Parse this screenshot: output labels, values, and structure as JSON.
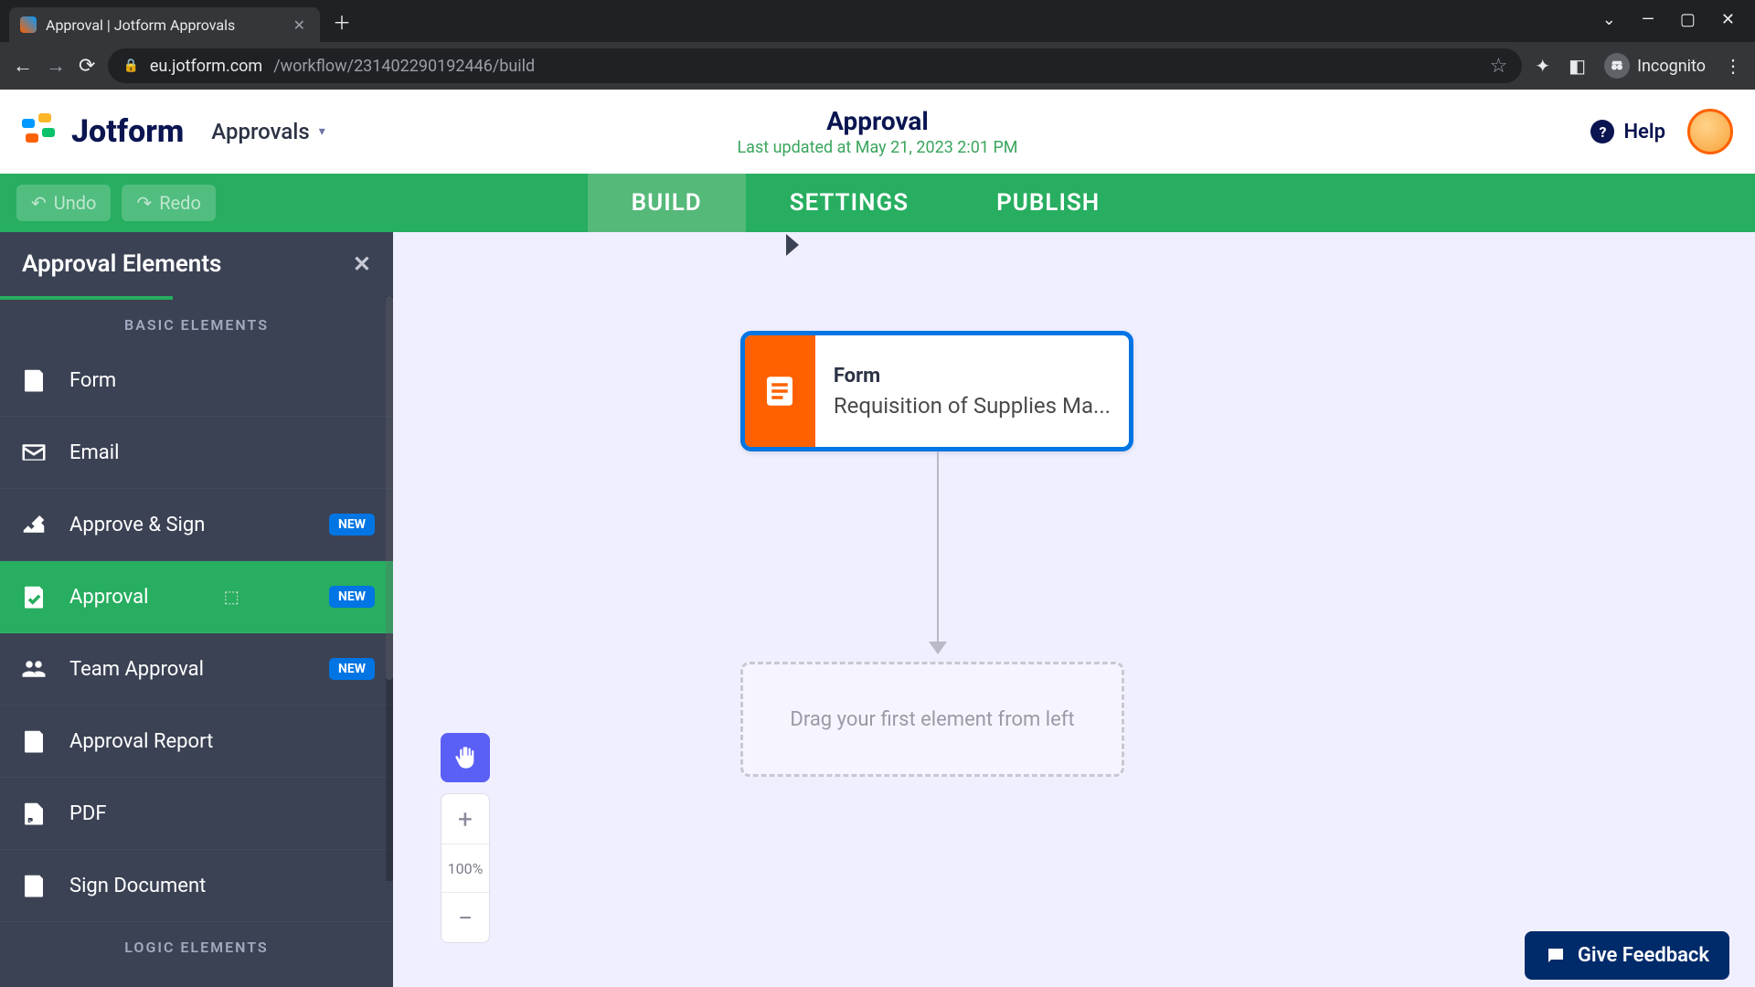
{
  "browser": {
    "tab_title": "Approval | Jotform Approvals",
    "url_host": "eu.jotform.com",
    "url_path": "/workflow/231402290192446/build",
    "incognito_label": "Incognito"
  },
  "header": {
    "logo_text": "Jotform",
    "breadcrumb": "Approvals",
    "title": "Approval",
    "subtitle": "Last updated at May 21, 2023 2:01 PM",
    "help_label": "Help"
  },
  "toolbar": {
    "undo": "Undo",
    "redo": "Redo"
  },
  "tabs": {
    "build": "BUILD",
    "settings": "SETTINGS",
    "publish": "PUBLISH"
  },
  "sidebar": {
    "title": "Approval Elements",
    "section_basic": "BASIC ELEMENTS",
    "section_logic": "LOGIC ELEMENTS",
    "new_badge": "NEW",
    "items": [
      {
        "label": "Form",
        "badge": false
      },
      {
        "label": "Email",
        "badge": false
      },
      {
        "label": "Approve & Sign",
        "badge": true
      },
      {
        "label": "Approval",
        "badge": true
      },
      {
        "label": "Team Approval",
        "badge": true
      },
      {
        "label": "Approval Report",
        "badge": false
      },
      {
        "label": "PDF",
        "badge": false
      },
      {
        "label": "Sign Document",
        "badge": false
      }
    ]
  },
  "canvas": {
    "node_title": "Form",
    "node_subtitle": "Requisition of Supplies Ma...",
    "dropzone_text": "Drag your first element from left",
    "zoom": "100%"
  },
  "feedback": {
    "label": "Give Feedback"
  }
}
